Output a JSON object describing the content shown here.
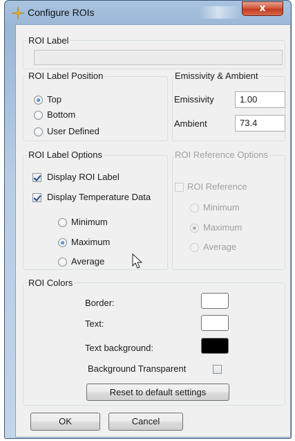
{
  "window": {
    "title": "Configure ROIs",
    "close_glyph": "x",
    "icon": "crosshair-star-icon"
  },
  "roi_label": {
    "legend": "ROI Label",
    "value": ""
  },
  "roi_label_position": {
    "legend": "ROI Label Position",
    "options": [
      "Top",
      "Bottom",
      "User Defined"
    ],
    "selected": "Top"
  },
  "emissivity_ambient": {
    "legend": "Emissivity & Ambient",
    "emissivity_label": "Emissivity",
    "emissivity_value": "1.00",
    "ambient_label": "Ambient",
    "ambient_value": "73.4"
  },
  "roi_label_options": {
    "legend": "ROI Label Options",
    "display_label": "Display ROI Label",
    "display_label_checked": true,
    "display_temp": "Display Temperature Data",
    "display_temp_checked": true,
    "temp_options": [
      "Minimum",
      "Maximum",
      "Average"
    ],
    "temp_selected": "Maximum"
  },
  "roi_reference_options": {
    "legend": "ROI Reference Options",
    "reference_label": "ROI Reference",
    "reference_checked": false,
    "options": [
      "Minimum",
      "Maximum",
      "Average"
    ],
    "selected": "Maximum",
    "enabled": false
  },
  "roi_colors": {
    "legend": "ROI Colors",
    "border_label": "Border:",
    "border_color": "#ffffff",
    "text_label": "Text:",
    "text_color": "#ffffff",
    "text_bg_label": "Text background:",
    "text_bg_color": "#000000",
    "bg_transparent_label": "Background Transparent",
    "bg_transparent_checked": false,
    "reset_label": "Reset to default settings"
  },
  "footer": {
    "ok_label": "OK",
    "cancel_label": "Cancel"
  }
}
